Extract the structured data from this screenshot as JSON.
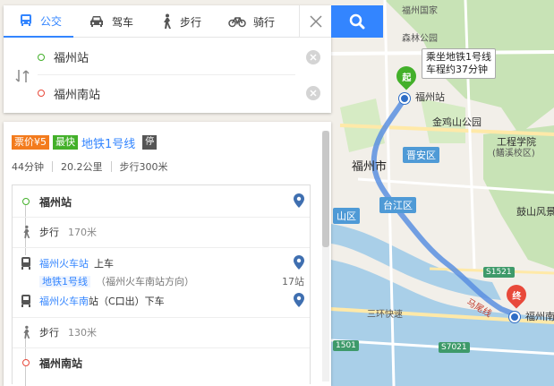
{
  "colors": {
    "accent": "#3385ff",
    "start_green": "#43b02a",
    "end_red": "#e8493a",
    "price_orange": "#f37b1d",
    "route_blue": "#3f7fd6"
  },
  "modes": [
    {
      "label": "公交",
      "icon": "bus-icon",
      "active": true
    },
    {
      "label": "驾车",
      "icon": "car-icon",
      "active": false
    },
    {
      "label": "步行",
      "icon": "walk-icon",
      "active": false
    },
    {
      "label": "骑行",
      "icon": "bike-icon",
      "active": false
    }
  ],
  "search": {
    "from_value": "福州站",
    "to_value": "福州南站"
  },
  "result": {
    "price_tag": "票价¥5",
    "fastest_tag": "最快",
    "line_name": "地铁1号线",
    "stop_tag": "停",
    "duration": "44分钟",
    "distance": "20.2公里",
    "walking": "步行300米"
  },
  "steps": {
    "start": "福州站",
    "walk1_label": "步行",
    "walk1_dist": "170米",
    "board_station": "福州火车站",
    "board_action": "上车",
    "line_chip": "地铁1号线",
    "direction": "（福州火车南站方向）",
    "stop_count": "17站",
    "alight_station": "福州火车南",
    "alight_station_suffix": "站（C口出）下车",
    "walk2_label": "步行",
    "walk2_dist": "130米",
    "end": "福州南站"
  },
  "map": {
    "bubble_line1": "乘坐地铁1号线",
    "bubble_line2": "车程约37分钟",
    "start_pin": "起",
    "end_pin": "终",
    "labels": {
      "fuzhou_national": "福州国家",
      "forest_park": "森林公园",
      "fuzhou_station": "福州站",
      "jinjishan": "金鸡山公园",
      "city": "福州市",
      "engineering": "工程学院",
      "engineering_sub": "(鳝溪校区)",
      "gushan": "鼓山风景",
      "fuzhou_south": "福州南",
      "sanhuan": "三环快速",
      "shan_district": "山区"
    },
    "districts": {
      "jinan": "晋安区",
      "taijiang": "台江区"
    },
    "roads": {
      "s1521": "S1521",
      "s7021": "S7021",
      "r501": "1501",
      "mawei": "马尾线"
    }
  }
}
